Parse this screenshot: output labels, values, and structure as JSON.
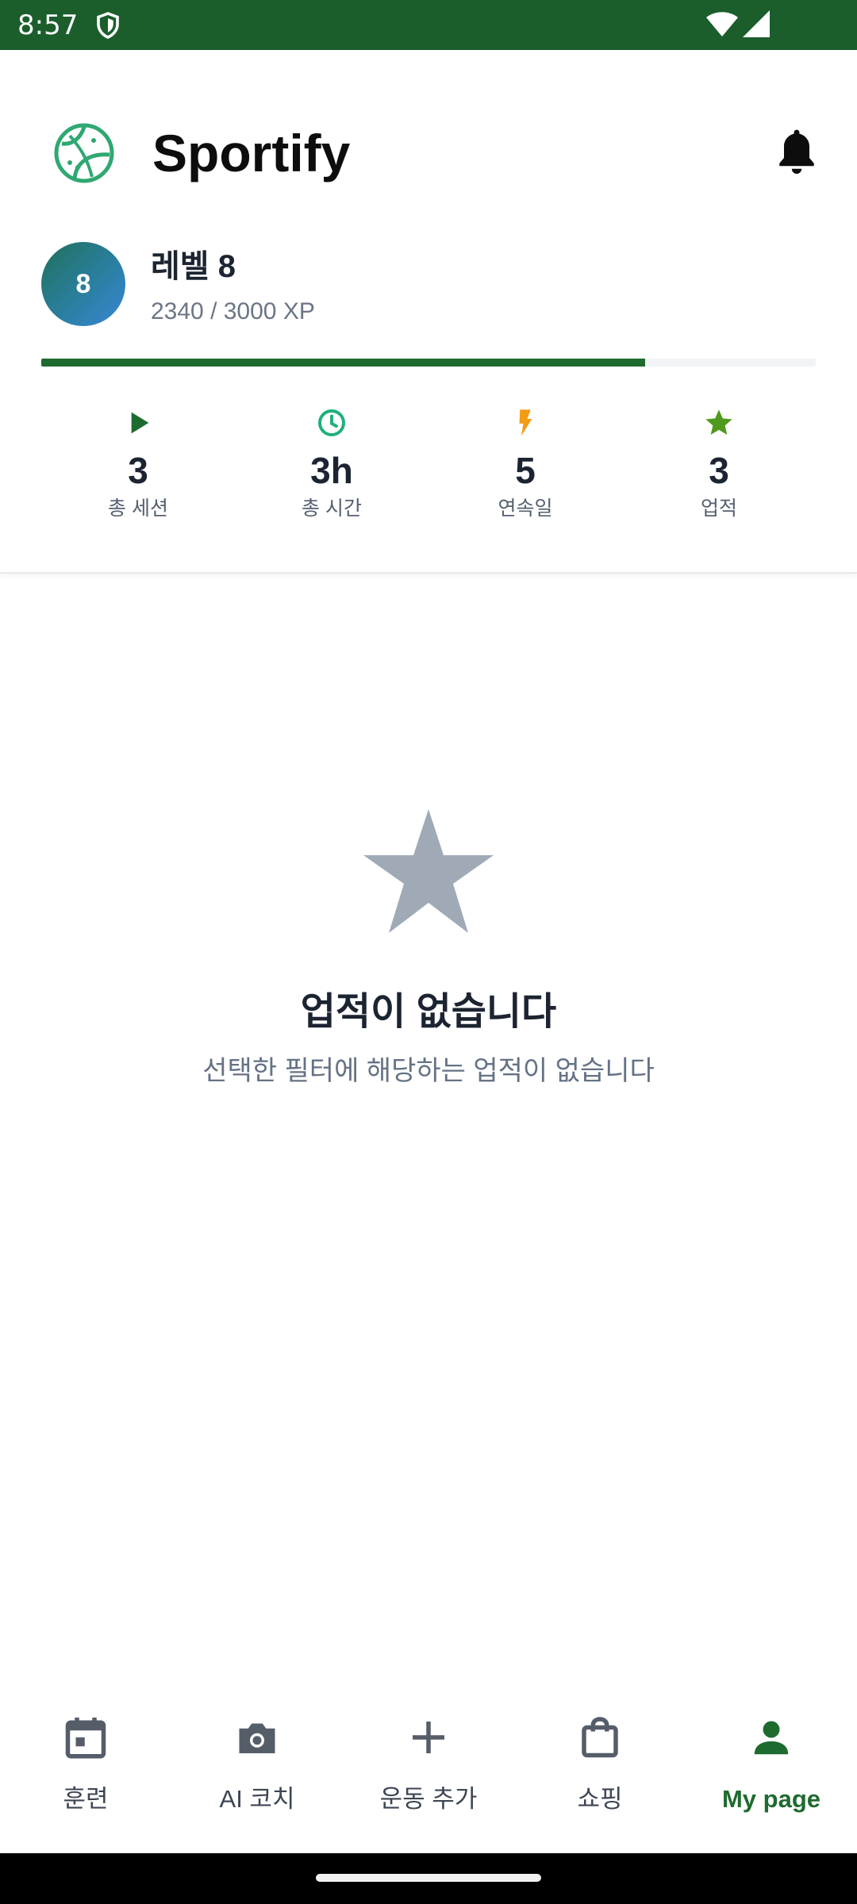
{
  "status_bar": {
    "time": "8:57"
  },
  "header": {
    "app_title": "Sportify",
    "level": {
      "badge": "8",
      "title": "레벨 8",
      "xp_text": "2340 / 3000 XP",
      "progress": 0.78
    },
    "stats": [
      {
        "icon": "play-icon",
        "color": "#1e6b2f",
        "value": "3",
        "label": "총 세션"
      },
      {
        "icon": "clock-icon",
        "color": "#20b07a",
        "value": "3h",
        "label": "총 시간"
      },
      {
        "icon": "lightning-icon",
        "color": "#f39c12",
        "value": "5",
        "label": "연속일"
      },
      {
        "icon": "star-icon",
        "color": "#4f9a1c",
        "value": "3",
        "label": "업적"
      }
    ]
  },
  "empty_state": {
    "title": "업적이 없습니다",
    "subtitle": "선택한 필터에 해당하는 업적이 없습니다"
  },
  "bottom_nav": [
    {
      "icon": "calendar-icon",
      "label": "훈련",
      "active": false
    },
    {
      "icon": "camera-icon",
      "label": "AI 코치",
      "active": false
    },
    {
      "icon": "plus-icon",
      "label": "운동 추가",
      "active": false
    },
    {
      "icon": "shopping-bag-icon",
      "label": "쇼핑",
      "active": false
    },
    {
      "icon": "person-icon",
      "label": "My page",
      "active": true
    }
  ],
  "colors": {
    "status_bar": "#1b5e2c",
    "accent": "#1e6b2f",
    "empty_star": "#a0aab7"
  }
}
